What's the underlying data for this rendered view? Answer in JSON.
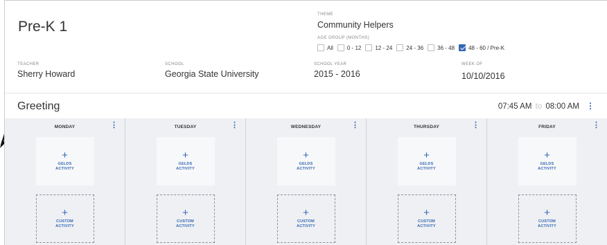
{
  "class_name": "Pre-K 1",
  "theme": {
    "label": "THEME",
    "value": "Community Helpers"
  },
  "age_group": {
    "label": "AGE GROUP (MONTHS)",
    "options": [
      {
        "label": "All",
        "checked": false
      },
      {
        "label": "0 - 12",
        "checked": false
      },
      {
        "label": "12 - 24",
        "checked": false
      },
      {
        "label": "24 - 36",
        "checked": false
      },
      {
        "label": "36 - 48",
        "checked": false
      },
      {
        "label": "48 - 60 / Pre-K",
        "checked": true
      }
    ]
  },
  "teacher": {
    "label": "TEACHER",
    "value": "Sherry Howard"
  },
  "school": {
    "label": "SCHOOL",
    "value": "Georgia State University"
  },
  "school_year": {
    "label": "SCHOOL YEAR",
    "value": "2015 - 2016"
  },
  "week_of": {
    "label": "WEEK OF",
    "value": "10/10/2016"
  },
  "section": {
    "title": "Greeting",
    "start_time": "07:45 AM",
    "separator": "to",
    "end_time": "08:00 AM"
  },
  "days": [
    {
      "name": "MONDAY"
    },
    {
      "name": "TUESDAY"
    },
    {
      "name": "WEDNESDAY"
    },
    {
      "name": "THURSDAY"
    },
    {
      "name": "FRIDAY"
    }
  ],
  "card_labels": {
    "plus": "+",
    "geld_line1": "GELDS",
    "geld_line2": "ACTIVITY",
    "custom_line1": "CUSTOM",
    "custom_line2": "ACTIVITY"
  },
  "menu_glyph": "⋮",
  "colors": {
    "accent": "#3567b4",
    "day_column_bg": "#eef0f3",
    "card_bg": "#f7f8f9"
  }
}
